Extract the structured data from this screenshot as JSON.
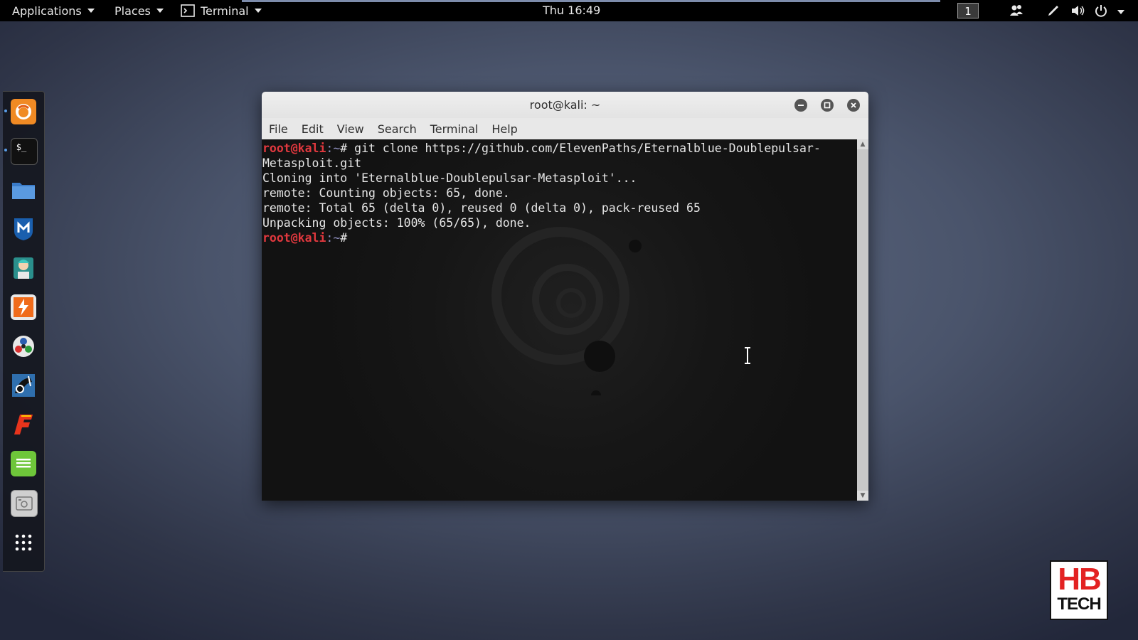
{
  "topbar": {
    "applications": "Applications",
    "places": "Places",
    "terminal_menu": "Terminal",
    "clock": "Thu 16:49",
    "workspace": "1"
  },
  "dock": {
    "items": [
      "firefox-icon",
      "terminal-icon",
      "files-icon",
      "metasploit-icon",
      "armitage-icon",
      "burpsuite-icon",
      "maltego-icon",
      "beef-icon",
      "faraday-icon",
      "notes-icon",
      "screenshot-icon",
      "show-apps-icon"
    ]
  },
  "window": {
    "title": "root@kali: ~",
    "menu": [
      "File",
      "Edit",
      "View",
      "Search",
      "Terminal",
      "Help"
    ]
  },
  "terminal": {
    "prompt_user": "root@kali",
    "prompt_path": ":~",
    "prompt_hash": "#",
    "command_1": " git clone https://github.com/ElevenPaths/Eternalblue-Doublepulsar-",
    "command_1_wrap": "Metasploit.git",
    "output": [
      "Cloning into 'Eternalblue-Doublepulsar-Metasploit'...",
      "remote: Counting objects: 65, done.",
      "remote: Total 65 (delta 0), reused 0 (delta 0), pack-reused 65",
      "Unpacking objects: 100% (65/65), done."
    ]
  },
  "logo": {
    "line1": "HB",
    "line2": "TECH"
  },
  "colors": {
    "prompt": "#e0383e",
    "terminal_bg": "#161616",
    "panel": "#000000"
  }
}
